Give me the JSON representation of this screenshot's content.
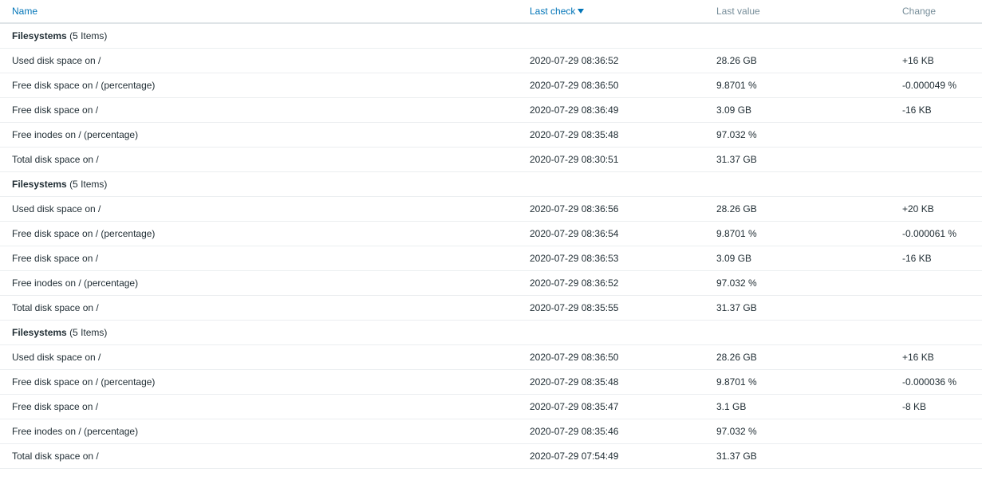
{
  "header": {
    "name": "Name",
    "last_check": "Last check",
    "last_value": "Last value",
    "change": "Change"
  },
  "groups": [
    {
      "name": "Filesystems",
      "count": "(5 Items)",
      "rows": [
        {
          "name": "Used disk space on /",
          "last_check": "2020-07-29 08:36:52",
          "last_value": "28.26 GB",
          "change": "+16 KB"
        },
        {
          "name": "Free disk space on / (percentage)",
          "last_check": "2020-07-29 08:36:50",
          "last_value": "9.8701 %",
          "change": "-0.000049 %"
        },
        {
          "name": "Free disk space on /",
          "last_check": "2020-07-29 08:36:49",
          "last_value": "3.09 GB",
          "change": "-16 KB"
        },
        {
          "name": "Free inodes on / (percentage)",
          "last_check": "2020-07-29 08:35:48",
          "last_value": "97.032 %",
          "change": ""
        },
        {
          "name": "Total disk space on /",
          "last_check": "2020-07-29 08:30:51",
          "last_value": "31.37 GB",
          "change": ""
        }
      ]
    },
    {
      "name": "Filesystems",
      "count": "(5 Items)",
      "rows": [
        {
          "name": "Used disk space on /",
          "last_check": "2020-07-29 08:36:56",
          "last_value": "28.26 GB",
          "change": "+20 KB"
        },
        {
          "name": "Free disk space on / (percentage)",
          "last_check": "2020-07-29 08:36:54",
          "last_value": "9.8701 %",
          "change": "-0.000061 %"
        },
        {
          "name": "Free disk space on /",
          "last_check": "2020-07-29 08:36:53",
          "last_value": "3.09 GB",
          "change": "-16 KB"
        },
        {
          "name": "Free inodes on / (percentage)",
          "last_check": "2020-07-29 08:36:52",
          "last_value": "97.032 %",
          "change": ""
        },
        {
          "name": "Total disk space on /",
          "last_check": "2020-07-29 08:35:55",
          "last_value": "31.37 GB",
          "change": ""
        }
      ]
    },
    {
      "name": "Filesystems",
      "count": "(5 Items)",
      "rows": [
        {
          "name": "Used disk space on /",
          "last_check": "2020-07-29 08:36:50",
          "last_value": "28.26 GB",
          "change": "+16 KB"
        },
        {
          "name": "Free disk space on / (percentage)",
          "last_check": "2020-07-29 08:35:48",
          "last_value": "9.8701 %",
          "change": "-0.000036 %"
        },
        {
          "name": "Free disk space on /",
          "last_check": "2020-07-29 08:35:47",
          "last_value": "3.1 GB",
          "change": "-8 KB"
        },
        {
          "name": "Free inodes on / (percentage)",
          "last_check": "2020-07-29 08:35:46",
          "last_value": "97.032 %",
          "change": ""
        },
        {
          "name": "Total disk space on /",
          "last_check": "2020-07-29 07:54:49",
          "last_value": "31.37 GB",
          "change": ""
        }
      ]
    }
  ]
}
